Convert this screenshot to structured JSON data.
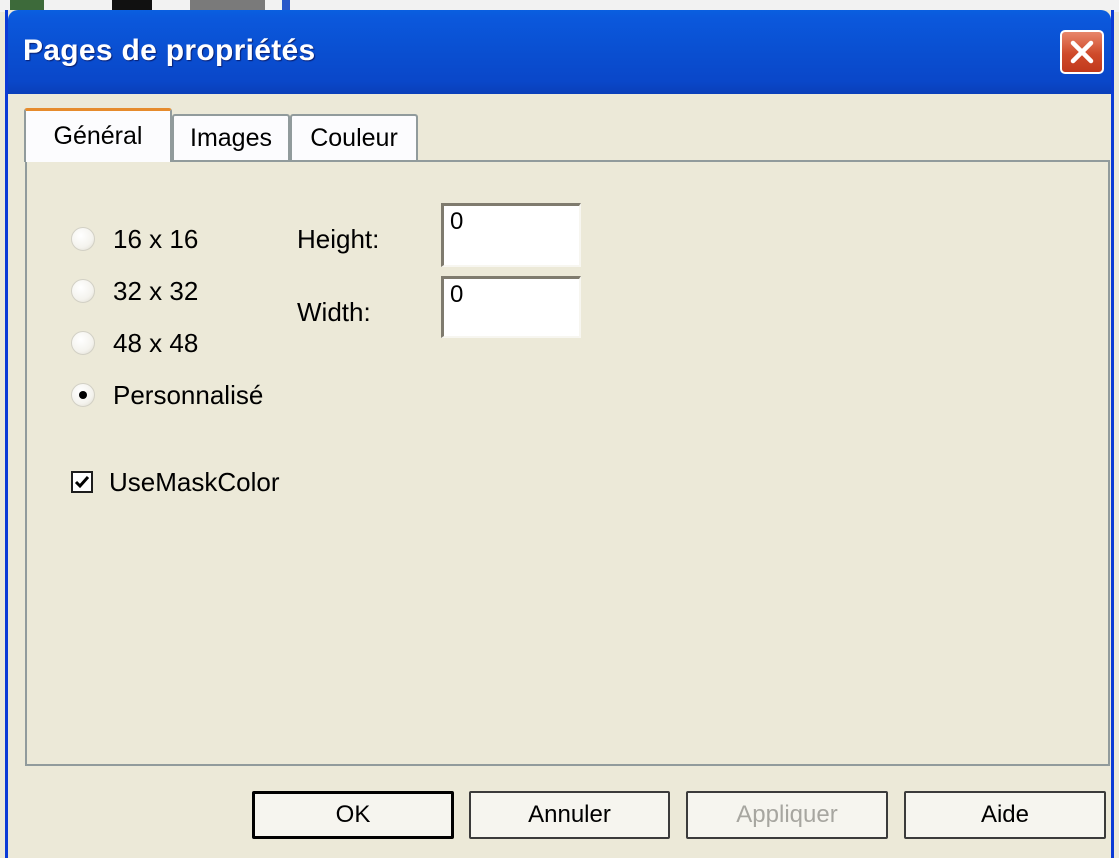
{
  "window": {
    "title": "Pages de propriétés"
  },
  "tabs": [
    {
      "label": "Général",
      "active": true
    },
    {
      "label": "Images",
      "active": false
    },
    {
      "label": "Couleur",
      "active": false
    }
  ],
  "general": {
    "size_options": [
      {
        "label": "16 x 16",
        "checked": false
      },
      {
        "label": "32 x 32",
        "checked": false
      },
      {
        "label": "48 x 48",
        "checked": false
      },
      {
        "label": "Personnalisé",
        "checked": true
      }
    ],
    "height_label": "Height:",
    "height_value": "0",
    "width_label": "Width:",
    "width_value": "0",
    "use_mask_color_label": "UseMaskColor",
    "use_mask_color_checked": true
  },
  "buttons": {
    "ok": "OK",
    "cancel": "Annuler",
    "apply": "Appliquer",
    "help": "Aide"
  },
  "colors": {
    "titlebar": "#0a4fd1",
    "dialog_bg": "#ece9d8",
    "active_tab_accent": "#e68b2c",
    "close_button": "#cf4a2a"
  }
}
